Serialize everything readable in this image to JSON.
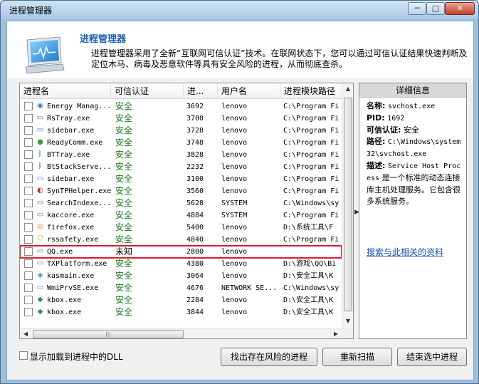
{
  "window": {
    "title": "进程管理器",
    "min": "─",
    "max": "□",
    "close": "✕"
  },
  "header": {
    "title": "进程管理器",
    "description": "进程管理器采用了全新“互联网可信认证”技术。在联网状态下，您可以通过可信认证结果快速判断及定位木马、病毒及恶意软件等具有安全风险的进程，从而彻底查杀。"
  },
  "columns": [
    "进程名",
    "可信认证",
    "进...",
    "用户名",
    "进程模块路径"
  ],
  "rows": [
    {
      "name": "Energy Manag...",
      "trust": "安全",
      "pid": "3692",
      "user": "lenovo",
      "path": "C:\\Program Fi",
      "icon": "energy-icon",
      "color": "#2a7fd4"
    },
    {
      "name": "RsTray.exe",
      "trust": "安全",
      "pid": "3700",
      "user": "lenovo",
      "path": "C:\\Program Fi",
      "icon": "window-icon",
      "color": "#4a78b0"
    },
    {
      "name": "sidebar.exe",
      "trust": "安全",
      "pid": "3728",
      "user": "lenovo",
      "path": "C:\\Program Fi",
      "icon": "window-icon",
      "color": "#4a78b0"
    },
    {
      "name": "ReadyComm.exe",
      "trust": "安全",
      "pid": "3748",
      "user": "lenovo",
      "path": "C:\\Program Fi",
      "icon": "globe-icon",
      "color": "#3a9a3a"
    },
    {
      "name": "BTTray.exe",
      "trust": "安全",
      "pid": "3828",
      "user": "lenovo",
      "path": "C:\\Program Fi",
      "icon": "bluetooth-icon",
      "color": "#1d5fc7"
    },
    {
      "name": "BtStackServe...",
      "trust": "安全",
      "pid": "2232",
      "user": "lenovo",
      "path": "C:\\Program Fi",
      "icon": "bluetooth-icon",
      "color": "#1d5fc7"
    },
    {
      "name": "sidebar.exe",
      "trust": "安全",
      "pid": "3100",
      "user": "lenovo",
      "path": "C:\\Program Fi",
      "icon": "window-icon",
      "color": "#4a78b0"
    },
    {
      "name": "SynTPHelper.exe",
      "trust": "安全",
      "pid": "3560",
      "user": "lenovo",
      "path": "C:\\Program Fi",
      "icon": "synaptics-icon",
      "color": "#c0262d"
    },
    {
      "name": "SearchIndexe...",
      "trust": "安全",
      "pid": "5628",
      "user": "SYSTEM",
      "path": "C:\\Windows\\sy",
      "icon": "window-icon",
      "color": "#4a78b0"
    },
    {
      "name": "kaccore.exe",
      "trust": "安全",
      "pid": "4884",
      "user": "SYSTEM",
      "path": "C:\\Program Fi",
      "icon": "window-icon",
      "color": "#4a78b0"
    },
    {
      "name": "firefox.exe",
      "trust": "安全",
      "pid": "5400",
      "user": "lenovo",
      "path": "D:\\系统工具\\F",
      "icon": "firefox-icon",
      "color": "#e8761e"
    },
    {
      "name": "rssafety.exe",
      "trust": "安全",
      "pid": "4840",
      "user": "lenovo",
      "path": "C:\\Program Fi",
      "icon": "shield-icon",
      "color": "#d9a41e"
    },
    {
      "name": "QQ.exe",
      "trust": "未知",
      "pid": "2800",
      "user": "lenovo",
      "path": "",
      "icon": "window-icon",
      "color": "#4a78b0"
    },
    {
      "name": "TXPlatform.exe",
      "trust": "安全",
      "pid": "4380",
      "user": "lenovo",
      "path": "D:\\游戏\\QQ\\Bi",
      "icon": "window-icon",
      "color": "#4a78b0"
    },
    {
      "name": "kasmain.exe",
      "trust": "安全",
      "pid": "3064",
      "user": "lenovo",
      "path": "D:\\安全工具\\K",
      "icon": "kasmain-icon",
      "color": "#3a7fbf"
    },
    {
      "name": "WmiPrvSE.exe",
      "trust": "安全",
      "pid": "4676",
      "user": "NETWORK SE...",
      "path": "C:\\Windows\\sy",
      "icon": "window-icon",
      "color": "#4a78b0"
    },
    {
      "name": "kbox.exe",
      "trust": "安全",
      "pid": "2284",
      "user": "lenovo",
      "path": "D:\\安全工具\\K",
      "icon": "kbox-icon",
      "color": "#3a8a5a"
    },
    {
      "name": "kbox.exe",
      "trust": "安全",
      "pid": "3844",
      "user": "lenovo",
      "path": "D:\\安全工具\\K",
      "icon": "kbox-icon",
      "color": "#3a8a5a"
    }
  ],
  "selected_row": 12,
  "detail": {
    "heading": "详细信息",
    "name_label": "名称:",
    "name_value": "svchost.exe",
    "pid_label": "PID:",
    "pid_value": "1692",
    "trust_label": "可信认证:",
    "trust_value": "安全",
    "path_label": "路径:",
    "path_value": "C:\\Windows\\system32\\svchost.exe",
    "desc_label": "描述:",
    "desc_value_en": "Service Host Process",
    "desc_value_cn": "是一个标准的动态连接库主机处理服务。它包含很多系统服务。",
    "link": "搜索与此相关的资料"
  },
  "footer": {
    "show_dll_label": "显示加载到进程中的DLL",
    "find_risk_button": "找出存在风险的进程",
    "rescan_button": "重新扫描",
    "end_process_button": "结束选中进程"
  },
  "colors": {
    "trust_safe": "#1b7a1b",
    "selection_outline": "#d21f2a",
    "link": "#1a4fb5",
    "title_blue": "#1a5fb4"
  }
}
